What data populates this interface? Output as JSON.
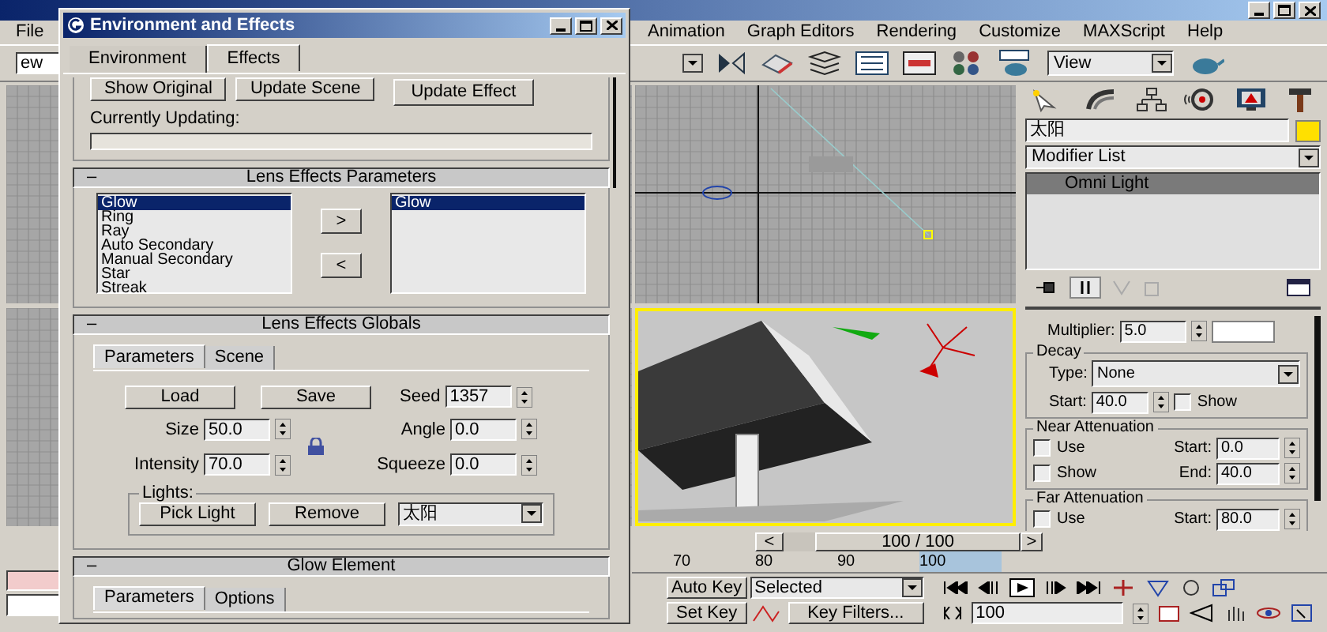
{
  "menu": [
    "File",
    "Animation",
    "Graph Editors",
    "Rendering",
    "Customize",
    "MAXScript",
    "Help"
  ],
  "toolbar": {
    "left_field": "ew",
    "view": "View"
  },
  "command_panel": {
    "object_name": "太阳",
    "modifier_list": "Modifier List",
    "stack": [
      {
        "label": "Omni Light",
        "selected": true
      }
    ],
    "multiplier_label": "Multiplier:",
    "multiplier": "5.0",
    "decay": {
      "title": "Decay",
      "type_label": "Type:",
      "type": "None",
      "start_label": "Start:",
      "start": "40.0",
      "show": {
        "label": "Show",
        "checked": false
      }
    },
    "near": {
      "title": "Near Attenuation",
      "use": {
        "label": "Use",
        "checked": false
      },
      "show": {
        "label": "Show",
        "checked": false
      },
      "start_label": "Start:",
      "start": "0.0",
      "end_label": "End:",
      "end": "40.0"
    },
    "far": {
      "title": "Far Attenuation",
      "use": {
        "label": "Use",
        "checked": false
      },
      "start_label": "Start:",
      "start": "80.0"
    }
  },
  "timeline": {
    "prev": "<",
    "position": "100 / 100",
    "level": 1,
    "next": ">",
    "ticks": [
      "70",
      "80",
      "90",
      "100"
    ],
    "auto_key": "Auto Key",
    "selection": "Selected",
    "set_key": "Set Key",
    "key_filters": "Key Filters...",
    "frame": "100"
  },
  "dialog": {
    "title": "Environment and Effects",
    "tabs": [
      {
        "label": "Environment",
        "selected": false
      },
      {
        "label": "Effects",
        "selected": true
      }
    ],
    "buttons": [
      "Show Original",
      "Update Scene",
      "Update Effect"
    ],
    "updating_label": "Currently Updating:",
    "progress": {
      "level": 0
    },
    "lens_params": {
      "toggle": "–",
      "title": "Lens Effects Parameters",
      "available": [
        {
          "label": "Glow",
          "selected": true
        },
        {
          "label": "Ring",
          "selected": false
        },
        {
          "label": "Ray",
          "selected": false
        },
        {
          "label": "Auto Secondary",
          "selected": false
        },
        {
          "label": "Manual Secondary",
          "selected": false
        },
        {
          "label": "Star",
          "selected": false
        },
        {
          "label": "Streak",
          "selected": false
        }
      ],
      "add": ">",
      "remove": "<",
      "active": [
        {
          "label": "Glow",
          "selected": true
        }
      ]
    },
    "lens_globals": {
      "toggle": "–",
      "title": "Lens Effects Globals",
      "tabs": [
        {
          "label": "Parameters",
          "selected": true
        },
        {
          "label": "Scene",
          "selected": false
        }
      ],
      "load": "Load",
      "save": "Save",
      "fields": [
        {
          "label": "Seed",
          "value": "1357"
        },
        {
          "label": "Size",
          "value": "50.0"
        },
        {
          "label": "Angle",
          "value": "0.0"
        },
        {
          "label": "Intensity",
          "value": "70.0"
        },
        {
          "label": "Squeeze",
          "value": "0.0"
        }
      ],
      "lights": {
        "title": "Lights:",
        "pick": "Pick Light",
        "remove": "Remove",
        "light": "太阳"
      }
    },
    "glow_element": {
      "toggle": "–",
      "title": "Glow Element",
      "tabs": [
        {
          "label": "Parameters",
          "selected": true
        },
        {
          "label": "Options",
          "selected": false
        }
      ]
    }
  }
}
